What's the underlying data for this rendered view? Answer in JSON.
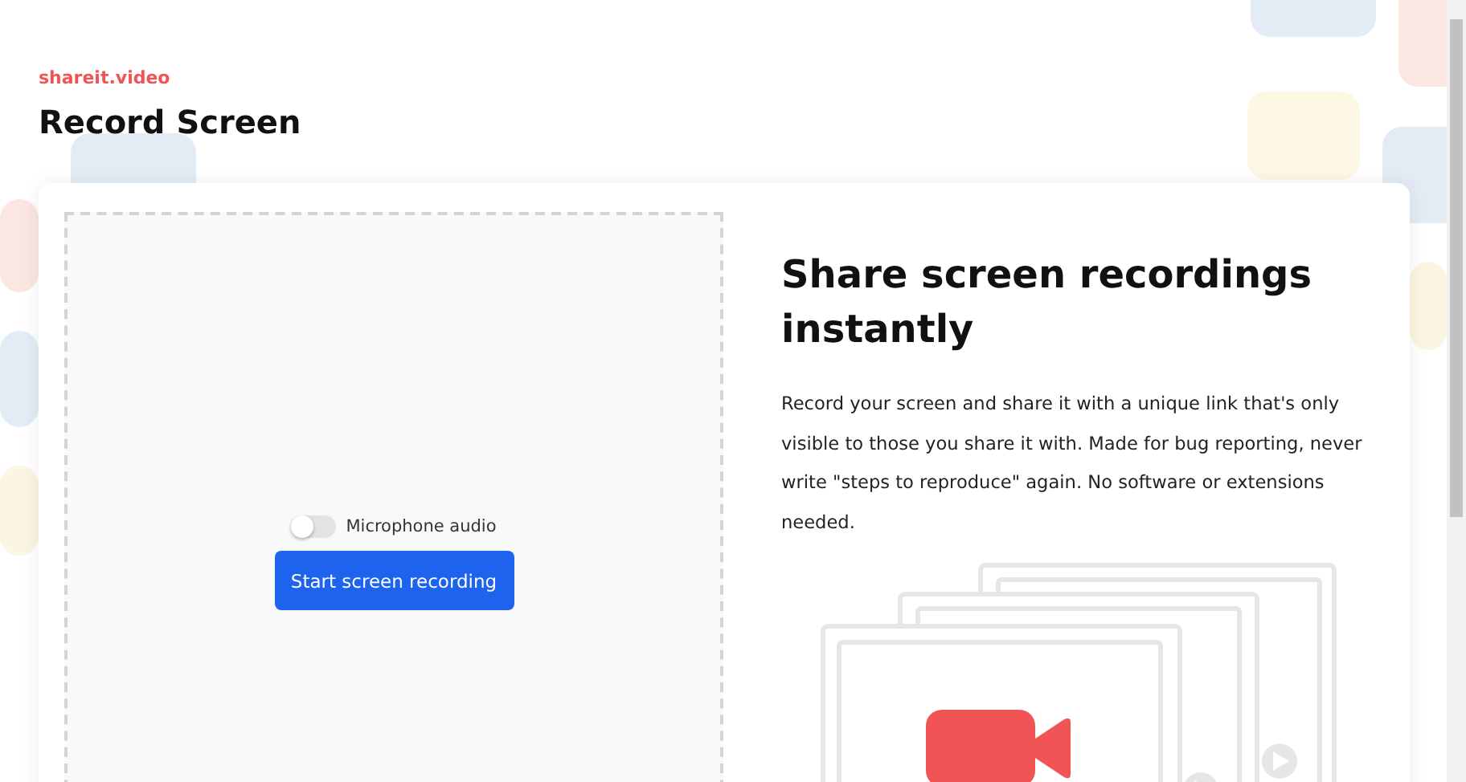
{
  "brand": "shareit.video",
  "title": "Record Screen",
  "recorder": {
    "microphone": {
      "label": "Microphone audio",
      "on": false
    },
    "button": "Start screen recording"
  },
  "info": {
    "heading": "Share screen recordings instantly",
    "text": "Record your screen and share it with a unique link that's only visible to those you share it with. Made for bug reporting, never write \"steps to reproduce\" again. No software or extensions needed."
  }
}
